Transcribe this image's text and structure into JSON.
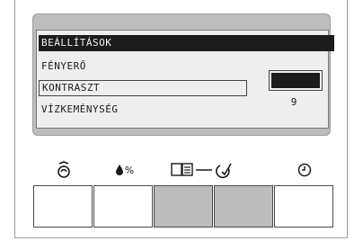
{
  "menu": {
    "header": "BEÁLLÍTÁSOK",
    "items": [
      "FÉNYERŐ",
      "KONTRASZT",
      "VÍZKEMÉNYSÉG"
    ],
    "selected_index": 1,
    "value": "9"
  },
  "icons": {
    "descale": "descale-icon",
    "water_hardness_unit": "%",
    "water_hardness": "water-drop-icon",
    "manual": "book-icon",
    "confirm": "check-icon",
    "timer": "clock-icon"
  },
  "buttons": [
    {
      "name": "descale-button",
      "pressed": false
    },
    {
      "name": "water-hardness-button",
      "pressed": false
    },
    {
      "name": "menu-button",
      "pressed": true
    },
    {
      "name": "ok-button",
      "pressed": true
    },
    {
      "name": "timer-button",
      "pressed": false
    }
  ],
  "colors": {
    "display_bg": "#eeeeee",
    "highlight": "#1c1c1c",
    "bezel": "#bdbdbd",
    "pressed_button": "#bcbcbc"
  }
}
